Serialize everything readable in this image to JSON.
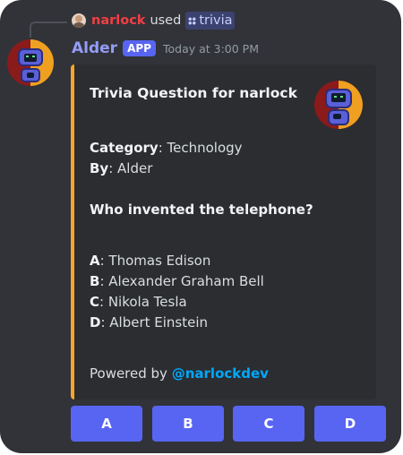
{
  "reply": {
    "user": "narlock",
    "used": "used",
    "command": "trivia"
  },
  "message": {
    "bot_name": "Alder",
    "app_badge": "APP",
    "timestamp": "Today at 3:00 PM"
  },
  "embed": {
    "title": "Trivia Question for narlock",
    "category_label": "Category",
    "category_value": ": Technology",
    "by_label": "By",
    "by_value": ": Alder",
    "question": "Who invented the telephone?",
    "options": [
      {
        "letter": "A",
        "text": ": Thomas Edison"
      },
      {
        "letter": "B",
        "text": ": Alexander Graham Bell"
      },
      {
        "letter": "C",
        "text": ": Nikola Tesla"
      },
      {
        "letter": "D",
        "text": ": Albert Einstein"
      }
    ],
    "footer_prefix": "Powered by",
    "footer_link": "@narlockdev"
  },
  "buttons": [
    "A",
    "B",
    "C",
    "D"
  ],
  "colors": {
    "background": "#313338",
    "embed_bg": "#2b2d31",
    "embed_accent": "#f9a62b",
    "blurple": "#5865f2",
    "bot_name": "#949cf7",
    "reply_user": "#f23f43",
    "link": "#00a8fc"
  },
  "icons": {
    "reply_avatar": "user-avatar",
    "command": "slash-command-icon",
    "bot_avatar": "robot-avatar",
    "thumbnail": "robot-thumbnail"
  }
}
